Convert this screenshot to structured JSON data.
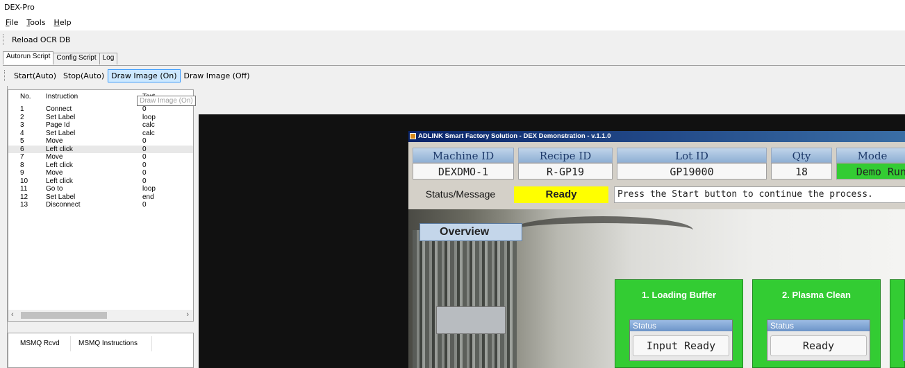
{
  "window": {
    "title": "DEX-Pro"
  },
  "menu": [
    "File",
    "Tools",
    "Help"
  ],
  "toolbar": {
    "reload_label": "Reload OCR DB"
  },
  "tabs": [
    "Autorun Script",
    "Config Script",
    "Log"
  ],
  "subtoolbar": {
    "start": "Start(Auto)",
    "stop": "Stop(Auto)",
    "draw_on": "Draw Image (On)",
    "draw_off": "Draw Image (Off)"
  },
  "tooltip": "Draw Image (On)",
  "instructions": {
    "headers": [
      "No.",
      "Instruction",
      "Text"
    ],
    "rows": [
      [
        "1",
        "Connect",
        "0"
      ],
      [
        "2",
        "Set Label",
        "loop"
      ],
      [
        "3",
        "Page Id",
        "calc"
      ],
      [
        "4",
        "Set Label",
        "calc"
      ],
      [
        "5",
        "Move",
        "0"
      ],
      [
        "6",
        "Left click",
        "0"
      ],
      [
        "7",
        "Move",
        "0"
      ],
      [
        "8",
        "Left click",
        "0"
      ],
      [
        "9",
        "Move",
        "0"
      ],
      [
        "10",
        "Left click",
        "0"
      ],
      [
        "11",
        "Go to",
        "loop"
      ],
      [
        "12",
        "Set Label",
        "end"
      ],
      [
        "13",
        "Disconnect",
        "0"
      ]
    ],
    "selected_row": 6
  },
  "msmq": {
    "col1": "MSMQ Rcvd",
    "col2": "MSMQ Instructions"
  },
  "app": {
    "title": "ADLINK Smart Factory Solution - DEX Demonstration - v.1.1.0",
    "headers": {
      "machine": "Machine ID",
      "recipe": "Recipe ID",
      "lot": "Lot ID",
      "qty": "Qty",
      "mode": "Mode"
    },
    "values": {
      "machine": "DEXDMO-1",
      "recipe": "R-GP19",
      "lot": "GP19000",
      "qty": "18",
      "mode": "Demo Run"
    },
    "status_label": "Status/Message",
    "status_value": "Ready",
    "message": "Press the Start button to continue the process.",
    "overview": "Overview",
    "stages": [
      {
        "name": "1. Loading Buffer",
        "status_label": "Status",
        "status": "Input Ready"
      },
      {
        "name": "2. Plasma Clean",
        "status_label": "Status",
        "status": "Ready"
      }
    ]
  },
  "colors": {
    "ready": "#ffff00",
    "stage": "#33cc33",
    "mode": "#33cc33",
    "header": "#8fb0d4"
  }
}
